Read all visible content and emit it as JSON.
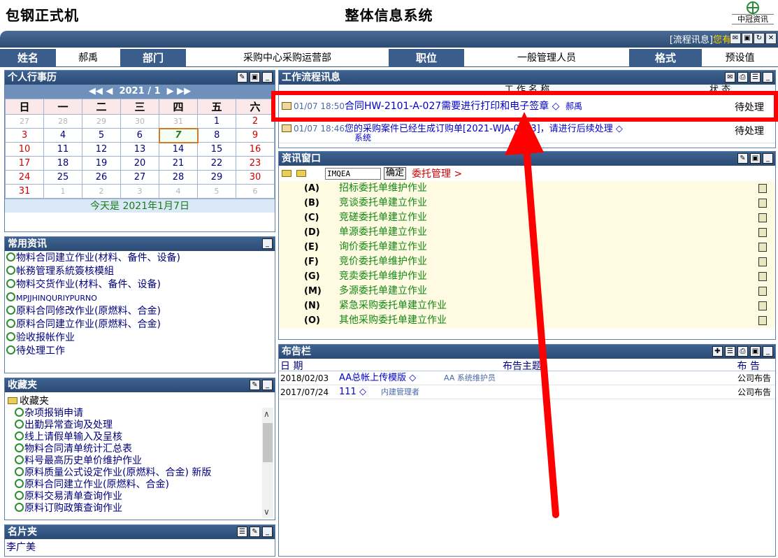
{
  "header": {
    "app_title": "包钢正式机",
    "system_title": "整体信息系统",
    "brand": "中冠资讯",
    "nav_message_prefix": "[流程讯息]",
    "nav_message_highlight": "您有新"
  },
  "user": {
    "name_label": "姓名",
    "name_value": "郝禹",
    "dept_label": "部门",
    "dept_value": "采购中心采购运营部",
    "position_label": "职位",
    "position_value": "一般管理人员",
    "format_label": "格式",
    "format_value": "预设值"
  },
  "calendar": {
    "title": "个人行事历",
    "nav_prev_year": "◀◀",
    "nav_prev_month": "◀",
    "year": "2021",
    "sep": "/",
    "month": "1",
    "nav_next_month": "▶",
    "nav_next_year": "▶▶",
    "weekdays": [
      "日",
      "一",
      "二",
      "三",
      "四",
      "五",
      "六"
    ],
    "today_text": "今天是 2021年1月7日"
  },
  "common": {
    "title": "常用资讯",
    "items": [
      "物料合同建立作业(材料、备件、设备)",
      "帐務管理系統簽核模組",
      "物料交货作业(材料、备件、设备)",
      "MPJJHINQURIYPURNO",
      "原料合同修改作业(原燃料、合金)",
      "原料合同建立作业(原燃料、合金)",
      "验收报帐作业",
      "待处理工作"
    ]
  },
  "favorites": {
    "title": "收藏夹",
    "root": "收藏夹",
    "items": [
      "杂项报销申请",
      "出勤异常查询及处理",
      "线上请假单输入及呈核",
      "物料合同清单统计汇总表",
      "料号最高历史单价维护作业",
      "原料质量公式设定作业(原燃料、合金) 新版",
      "原料合同建立作业(原燃料、合金)",
      "原料交易清单查询作业",
      "原料订购政策查询作业"
    ]
  },
  "cards": {
    "title": "名片夹",
    "items": [
      "李广美"
    ]
  },
  "workflow": {
    "title": "工作流程讯息",
    "col_name": "工 作 名 称",
    "col_status": "状 态",
    "rows": [
      {
        "time": "01/07 18:50",
        "text": "合同HW-2101-A-027需要进行打印和电子签章 ◇",
        "sender": "郝禹",
        "status": "待处理"
      },
      {
        "time": "01/07 18:46",
        "text": "您的采购案件已经生成订购单[2021-WJA-0003]，请进行后续处理 ◇",
        "sender": "系统",
        "status": "待处理"
      }
    ]
  },
  "info": {
    "title": "资讯窗口",
    "input_value": "IMQEA",
    "confirm": "确定",
    "crumb": "委托管理 >",
    "items": [
      {
        "key": "(A)",
        "label": "招标委托单维护作业"
      },
      {
        "key": "(B)",
        "label": "竞谈委托单建立作业"
      },
      {
        "key": "(C)",
        "label": "竞磋委托单建立作业"
      },
      {
        "key": "(D)",
        "label": "单源委托单建立作业"
      },
      {
        "key": "(E)",
        "label": "询价委托单建立作业"
      },
      {
        "key": "(F)",
        "label": "竞价委托单维护作业"
      },
      {
        "key": "(G)",
        "label": "竞卖委托单维护作业"
      },
      {
        "key": "(M)",
        "label": "多源委托单建立作业"
      },
      {
        "key": "(N)",
        "label": "紧急采购委托单建立作业"
      },
      {
        "key": "(O)",
        "label": "其他采购委托单建立作业"
      }
    ]
  },
  "bulletin": {
    "title": "布告栏",
    "col_date": "日 期",
    "col_subject": "布告主题",
    "col_type": "布 告",
    "rows": [
      {
        "date": "2018/02/03",
        "subject": "AA总帐上传模版 ◇",
        "author": "AA 系统维护员",
        "type": "公司布告"
      },
      {
        "date": "2017/07/24",
        "subject": "111 ◇",
        "author": "内建管理者",
        "type": "公司布告"
      }
    ]
  },
  "colors": {
    "header_blue": "#2b4a74",
    "annotation_red": "#ff0000",
    "link_green": "#118811"
  }
}
